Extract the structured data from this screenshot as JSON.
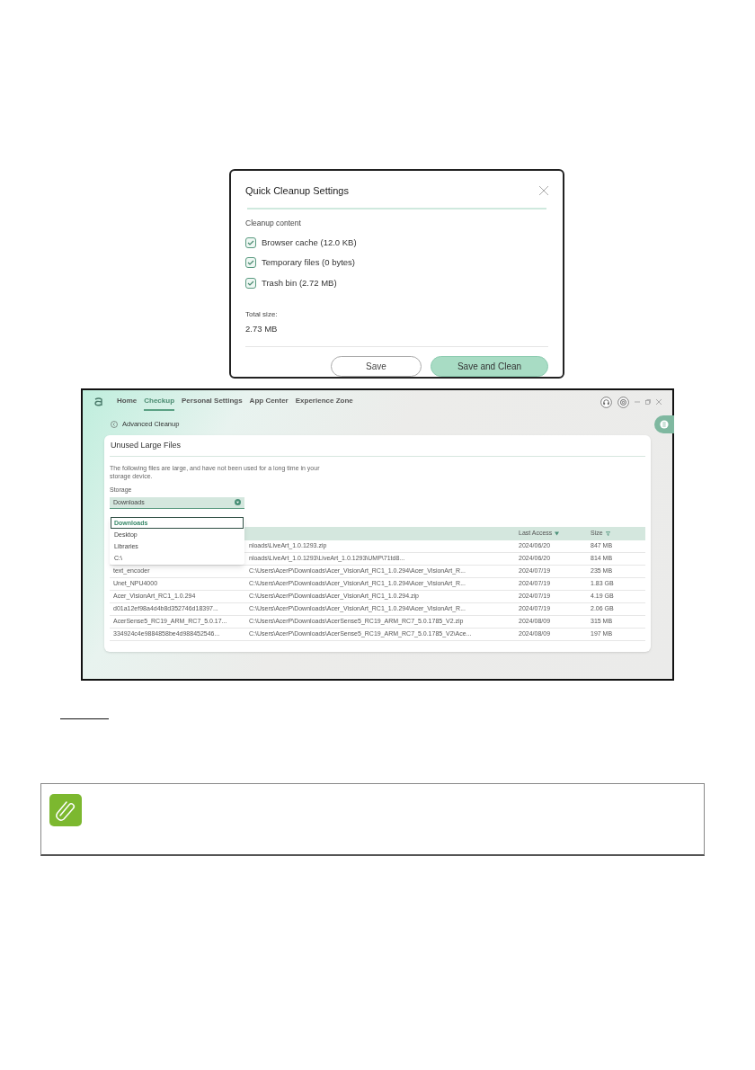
{
  "dialog": {
    "title": "Quick Cleanup Settings",
    "section": "Cleanup content",
    "options": [
      {
        "label": "Browser cache (12.0 KB)",
        "checked": true
      },
      {
        "label": "Temporary files (0 bytes)",
        "checked": true
      },
      {
        "label": "Trash bin (2.72 MB)",
        "checked": true
      }
    ],
    "total_label": "Total size:",
    "total_value": "2.73 MB",
    "buttons": [
      {
        "label": "Save",
        "kind": "secondary"
      },
      {
        "label": "Save and Clean",
        "kind": "primary"
      }
    ]
  },
  "app": {
    "nav": [
      {
        "label": "Home",
        "selected": false
      },
      {
        "label": "Checkup",
        "selected": true
      },
      {
        "label": "Personal Settings",
        "selected": false
      },
      {
        "label": "App Center",
        "selected": false
      },
      {
        "label": "Experience Zone",
        "selected": false
      }
    ],
    "back_label": "Advanced Cleanup",
    "card": {
      "title": "Unused Large Files",
      "description": "The following files are large, and have not been used for a long time in your storage device.",
      "storage_label": "Storage",
      "storage_value": "Downloads",
      "dropdown": [
        {
          "label": "Downloads",
          "selected": true
        },
        {
          "label": "Desktop",
          "selected": false
        },
        {
          "label": "Libraries",
          "selected": false
        },
        {
          "label": "C:\\",
          "selected": false
        }
      ],
      "columns": [
        "Last Access",
        "Size"
      ],
      "rows": [
        {
          "path": "nloads\\LiveArt_1.0.1293.zip",
          "last_access": "2024/06/20",
          "size": "847 MB"
        },
        {
          "path": "nloads\\LiveArt_1.0.1293\\LiveArt_1.0.1293\\UMP\\71td8...",
          "last_access": "2024/06/20",
          "size": "814 MB"
        },
        {
          "name": "text_encoder",
          "path": "C:\\Users\\AcerP\\Downloads\\Acer_VisionArt_RC1_1.0.294\\Acer_VisionArt_R...",
          "last_access": "2024/07/19",
          "size": "235 MB"
        },
        {
          "name": "Unet_NPU4000",
          "path": "C:\\Users\\AcerP\\Downloads\\Acer_VisionArt_RC1_1.0.294\\Acer_VisionArt_R...",
          "last_access": "2024/07/19",
          "size": "1.83 GB"
        },
        {
          "name": "Acer_VisionArt_RC1_1.0.294",
          "path": "C:\\Users\\AcerP\\Downloads\\Acer_VisionArt_RC1_1.0.294.zip",
          "last_access": "2024/07/19",
          "size": "4.19 GB"
        },
        {
          "name": "d01a12ef98a4d4b8d352746d18397...",
          "path": "C:\\Users\\AcerP\\Downloads\\Acer_VisionArt_RC1_1.0.294\\Acer_VisionArt_R...",
          "last_access": "2024/07/19",
          "size": "2.06 GB"
        },
        {
          "name": "AcerSense5_RC19_ARM_RC7_5.0.17...",
          "path": "C:\\Users\\AcerP\\Downloads\\AcerSense5_RC19_ARM_RC7_5.0.1785_V2.zip",
          "last_access": "2024/08/09",
          "size": "315 MB"
        },
        {
          "name": "334924c4e9884858be4d988452546...",
          "path": "C:\\Users\\AcerP\\Downloads\\AcerSense5_RC19_ARM_RC7_5.0.1785_V2\\Ace...",
          "last_access": "2024/08/09",
          "size": "197 MB"
        }
      ]
    }
  }
}
